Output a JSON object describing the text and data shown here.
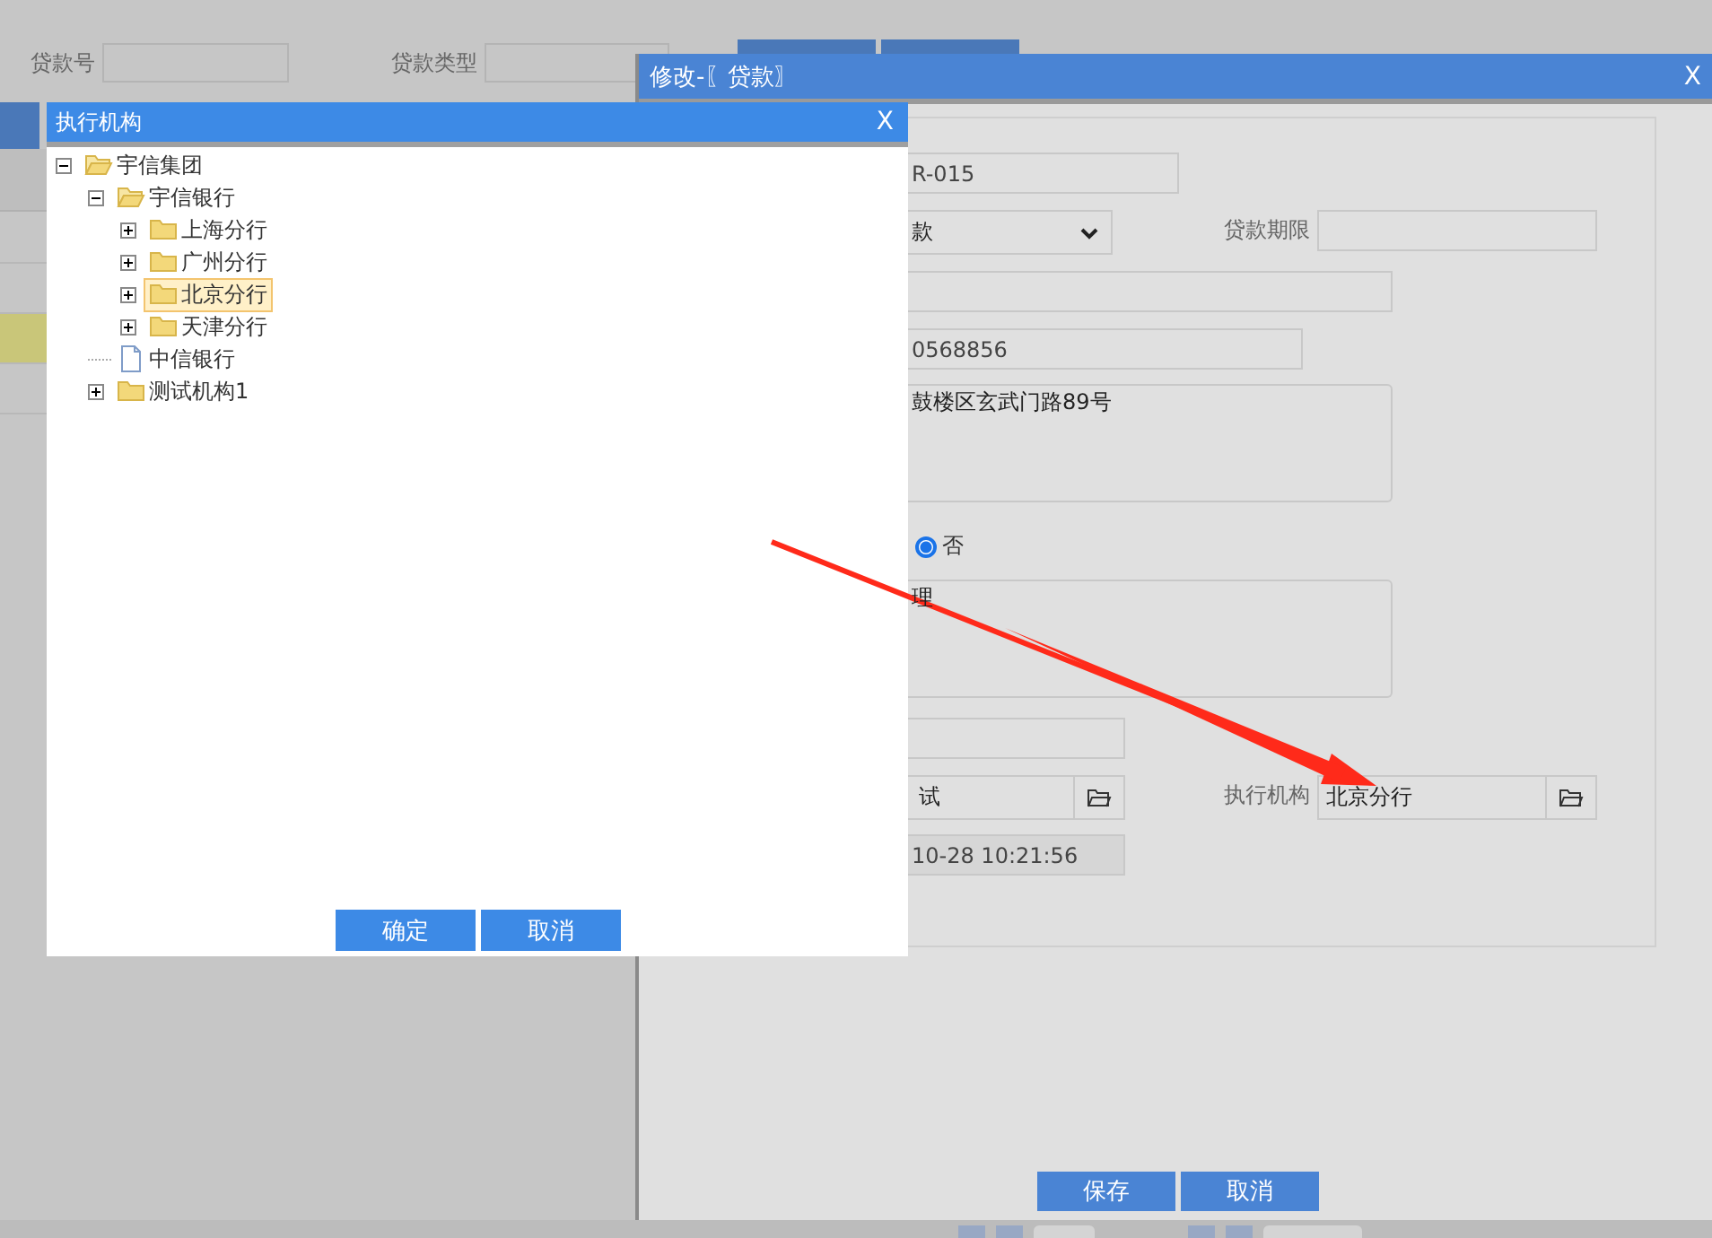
{
  "search_bar": {
    "fields": [
      {
        "label": "贷款号"
      },
      {
        "label": "贷款类型"
      }
    ]
  },
  "table": {
    "rows": [
      {
        "selected": false
      },
      {
        "selected": false
      },
      {
        "selected": true
      },
      {
        "selected": false
      }
    ]
  },
  "edit_dialog": {
    "title": "修改-〖贷款〗",
    "close": "X",
    "rows": [
      {
        "kind": "text",
        "value": "R-015"
      },
      {
        "kind": "select",
        "value": "款",
        "side": {
          "label": "贷款期限",
          "kind": "text"
        }
      },
      {
        "kind": "text"
      },
      {
        "kind": "text",
        "value": "0568856"
      },
      {
        "kind": "textarea",
        "value": "鼓楼区玄武门路89号"
      },
      {
        "kind": "radio",
        "options": [
          {
            "label": "否",
            "selected": true
          }
        ]
      },
      {
        "kind": "textarea",
        "value": "理"
      },
      {
        "kind": "text"
      },
      {
        "kind": "picker",
        "value": "试",
        "side": {
          "label": "执行机构",
          "kind": "picker",
          "value": "北京分行"
        }
      },
      {
        "kind": "readonly",
        "value": "10-28 10:21:56"
      }
    ],
    "buttons": [
      "保存",
      "取消"
    ]
  },
  "tree_dialog": {
    "title": "执行机构",
    "close": "X",
    "tree": [
      {
        "label": "宇信集团",
        "expanded": true,
        "selected": false,
        "children": [
          {
            "label": "宇信银行",
            "expanded": true,
            "selected": false,
            "children": [
              {
                "label": "上海分行",
                "expanded": false,
                "selected": false
              },
              {
                "label": "广州分行",
                "expanded": false,
                "selected": false
              },
              {
                "label": "北京分行",
                "expanded": false,
                "selected": true
              },
              {
                "label": "天津分行",
                "expanded": false,
                "selected": false
              }
            ]
          },
          {
            "label": "中信银行",
            "kind": "leaf",
            "selected": false
          },
          {
            "label": "测试机构1",
            "expanded": false,
            "selected": false
          }
        ]
      }
    ],
    "buttons": [
      "确定",
      "取消"
    ]
  }
}
